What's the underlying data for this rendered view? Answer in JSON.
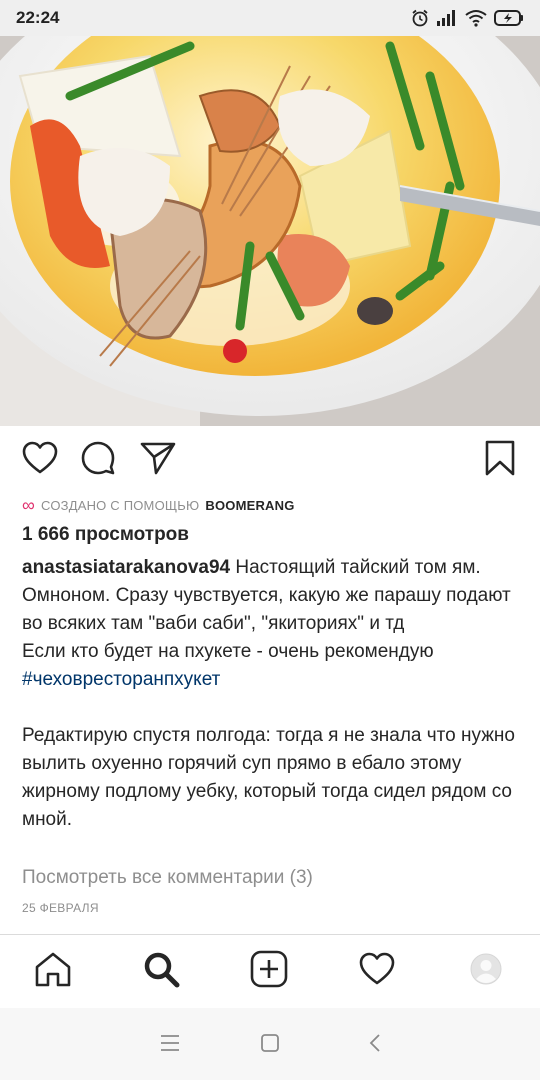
{
  "status_bar": {
    "time": "22:24",
    "icons": [
      "alarm-icon",
      "signal-icon",
      "wifi-icon",
      "battery-charging-icon"
    ]
  },
  "post": {
    "image": "photo-tom-yam-soup",
    "actions": [
      "heart-icon",
      "comment-icon",
      "share-icon",
      "bookmark-icon"
    ],
    "boomerang": {
      "prefix": "СОЗДАНО С ПОМОЩЬЮ",
      "brand": "BOOMERANG",
      "icon": "infinity-icon"
    },
    "views": "1 666 просмотров",
    "caption": {
      "username": "anastasiatarakanova94",
      "text1": "Настоящий тайский том ям. Омноном. Сразу чувствуется, какую же парашу подают во всяких там \"ваби саби\", \"якиториях\" и тд",
      "text2": "Если кто будет на пхукете - очень рекомендую",
      "hashtag": "#чеховресторанпхукет",
      "text3": "Редактирую  спустя полгода: тогда я не знала что нужно вылить охуенно горячий суп прямо в ебало этому жирному подлому уебку,  который тогда  сидел рядом со мной."
    },
    "view_comments": "Посмотреть все комментарии (3)",
    "date": "25 ФЕВРАЛЯ"
  },
  "bottom_nav": [
    "home-icon",
    "search-icon",
    "new-post-icon",
    "activity-heart-icon",
    "profile-avatar"
  ],
  "system_nav": [
    "menu-icon",
    "home-square-icon",
    "back-icon"
  ],
  "colors": {
    "text": "#262626",
    "muted": "#8e8e8e",
    "hashtag": "#003569",
    "boomerang_accent": "#e0336f",
    "status_bar_bg": "#efefef"
  }
}
